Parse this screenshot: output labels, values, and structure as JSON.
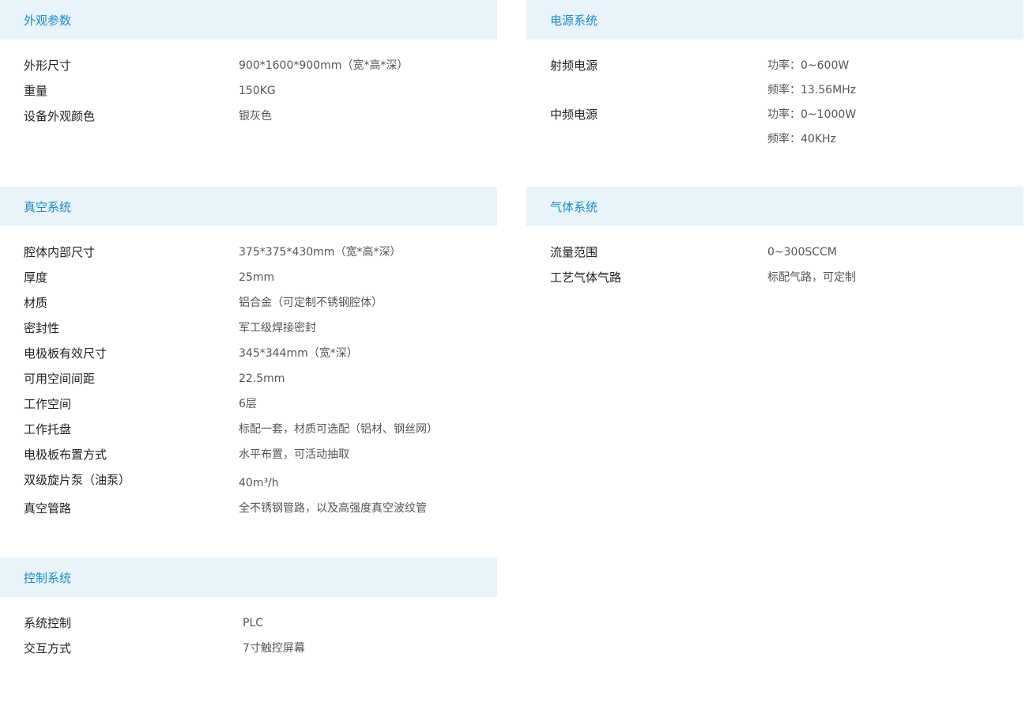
{
  "sections": {
    "appearance": {
      "title": "外观参数",
      "rows": [
        {
          "label": "外形尺寸",
          "value": "900*1600*900mm（宽*高*深）"
        },
        {
          "label": "重量",
          "value": "150KG"
        },
        {
          "label": "设备外观颜色",
          "value": "银灰色"
        }
      ]
    },
    "power": {
      "title": "电源系统",
      "rows": [
        {
          "label": "射频电源",
          "values": [
            "功率：0~600W",
            "频率：13.56MHz"
          ]
        },
        {
          "label": "中频电源",
          "values": [
            "功率：0~1000W",
            "频率：40KHz"
          ]
        }
      ]
    },
    "vacuum": {
      "title": "真空系统",
      "rows": [
        {
          "label": "腔体内部尺寸",
          "value": "375*375*430mm（宽*高*深）"
        },
        {
          "label": "厚度",
          "value": "25mm"
        },
        {
          "label": "材质",
          "value": "铝合金（可定制不锈钢腔体）"
        },
        {
          "label": "密封性",
          "value": "军工级焊接密封"
        },
        {
          "label": "电极板有效尺寸",
          "value": "345*344mm（宽*深）"
        },
        {
          "label": "可用空间间距",
          "value": "22.5mm"
        },
        {
          "label": "工作空间",
          "value": "6层"
        },
        {
          "label": "工作托盘",
          "value": "标配一套，材质可选配（铝材、钢丝网）"
        },
        {
          "label": "电极板布置方式",
          "value": "水平布置，可活动抽取"
        },
        {
          "label": "双级旋片泵（油泵）",
          "value": "40m³/h"
        },
        {
          "label": "真空管路",
          "value": "全不锈钢管路，以及高强度真空波纹管"
        }
      ]
    },
    "gas": {
      "title": "气体系统",
      "rows": [
        {
          "label": "流量范围",
          "value": "0~300SCCM"
        },
        {
          "label": "工艺气体气路",
          "value": "标配气路，可定制"
        }
      ]
    },
    "control": {
      "title": "控制系统",
      "rows": [
        {
          "label": "系统控制",
          "value": "PLC"
        },
        {
          "label": "交互方式",
          "value": "7寸触控屏幕"
        }
      ]
    }
  }
}
